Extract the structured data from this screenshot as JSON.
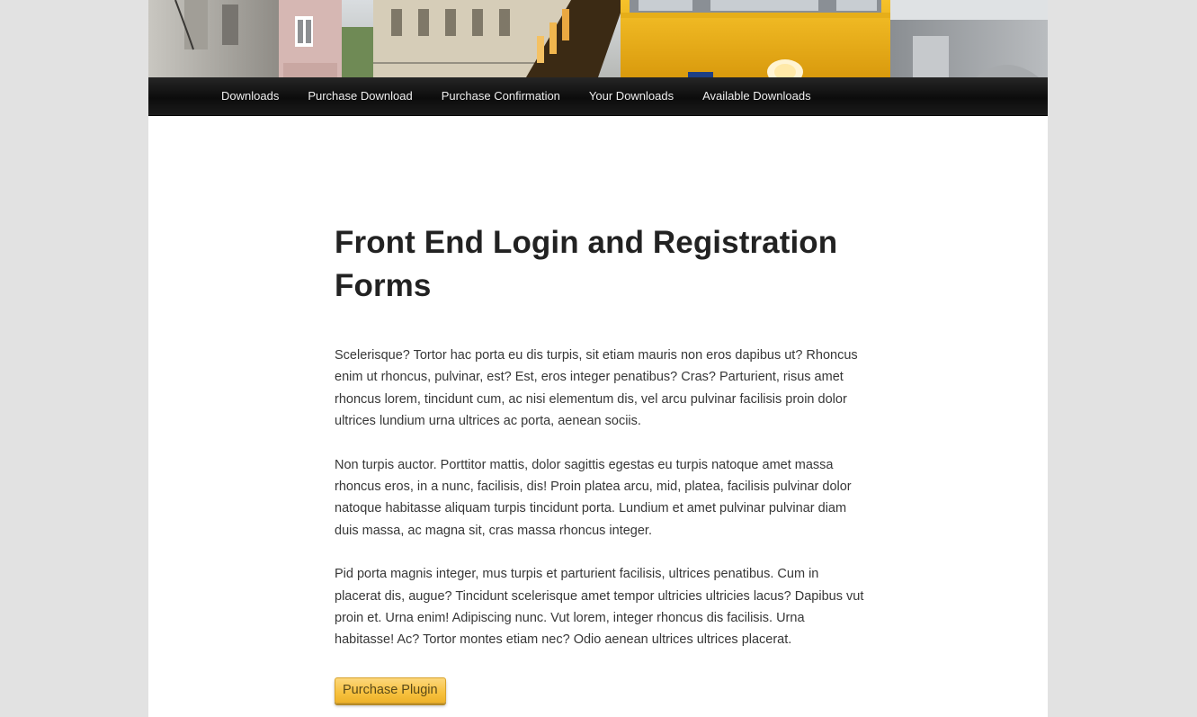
{
  "colors": {
    "page_background": "#e2e2e2",
    "content_background": "#ffffff",
    "nav_background": "#111111",
    "nav_text": "#eeeeee",
    "tram_yellow": "#f2b320",
    "button_yellow": "#f7c13e"
  },
  "header": {
    "image_icon": "street-tram-photo"
  },
  "nav": {
    "items": [
      {
        "label": "Downloads"
      },
      {
        "label": "Purchase Download"
      },
      {
        "label": "Purchase Confirmation"
      },
      {
        "label": "Your Downloads"
      },
      {
        "label": "Available Downloads"
      }
    ]
  },
  "main": {
    "title": "Front End Login and Registration Forms",
    "paragraphs": [
      "Scelerisque? Tortor hac porta eu dis turpis, sit etiam mauris non eros dapibus ut? Rhoncus enim ut rhoncus, pulvinar, est? Est, eros integer penatibus? Cras? Parturient, risus amet rhoncus lorem, tincidunt cum, ac nisi elementum dis, vel arcu pulvinar facilisis proin dolor ultrices lundium urna ultrices ac porta, aenean sociis.",
      "Non turpis auctor. Porttitor mattis, dolor sagittis egestas eu turpis natoque amet massa rhoncus eros, in a nunc, facilisis, dis! Proin platea arcu, mid, platea, facilisis pulvinar dolor natoque habitasse aliquam turpis tincidunt porta. Lundium et amet pulvinar pulvinar diam duis massa, ac magna sit, cras massa rhoncus integer.",
      "Pid porta magnis integer, mus turpis et parturient facilisis, ultrices penatibus. Cum in placerat dis, augue? Tincidunt scelerisque amet tempor ultricies ultricies lacus? Dapibus vut proin et. Urna enim! Adipiscing nunc. Vut lorem, integer rhoncus dis facilisis. Urna habitasse! Ac? Tortor montes etiam nec? Odio aenean ultrices ultrices placerat."
    ],
    "button_label": "Purchase Plugin"
  }
}
